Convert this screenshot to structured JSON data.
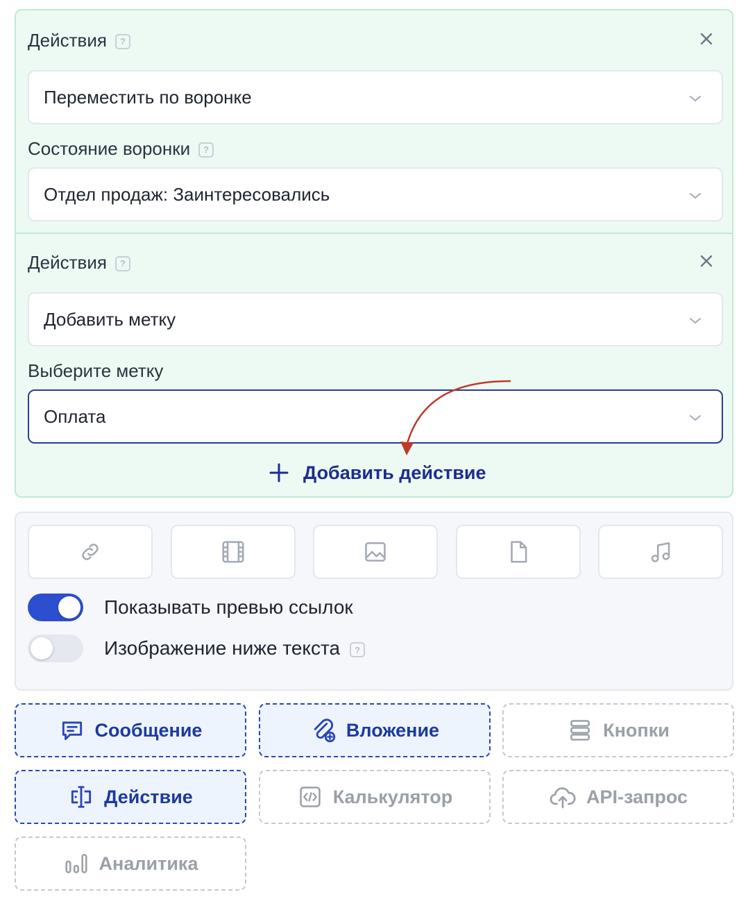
{
  "actions": [
    {
      "label": "Действия",
      "help": "?",
      "select_value": "Переместить по воронке",
      "sub_label": "Состояние воронки",
      "sub_help": "?",
      "sub_value": "Отдел продаж: Заинтересовались"
    },
    {
      "label": "Действия",
      "help": "?",
      "select_value": "Добавить метку",
      "sub_label": "Выберите метку",
      "sub_value": "Оплата"
    }
  ],
  "add_action_label": "Добавить действие",
  "media": {
    "buttons": [
      "link-icon",
      "film-icon",
      "image-icon",
      "file-icon",
      "music-icon"
    ],
    "toggles": [
      {
        "label": "Показывать превью ссылок",
        "state": "on"
      },
      {
        "label": "Изображение ниже текста",
        "state": "off",
        "help": "?"
      }
    ]
  },
  "blocks": [
    {
      "label": "Сообщение",
      "icon": "message-icon",
      "state": "active"
    },
    {
      "label": "Вложение",
      "icon": "attachment-icon",
      "state": "active"
    },
    {
      "label": "Кнопки",
      "icon": "buttons-icon",
      "state": "inactive"
    },
    {
      "label": "Действие",
      "icon": "action-icon",
      "state": "active"
    },
    {
      "label": "Калькулятор",
      "icon": "code-icon",
      "state": "inactive"
    },
    {
      "label": "API-запрос",
      "icon": "cloud-upload-icon",
      "state": "inactive"
    },
    {
      "label": "Аналитика",
      "icon": "analytics-icon",
      "state": "inactive"
    }
  ],
  "colors": {
    "panel_green": "#ecfaf3",
    "accent_blue": "#2b4fcf",
    "link_blue": "#1c2d8c",
    "annotation_arrow": "#c0392b"
  }
}
